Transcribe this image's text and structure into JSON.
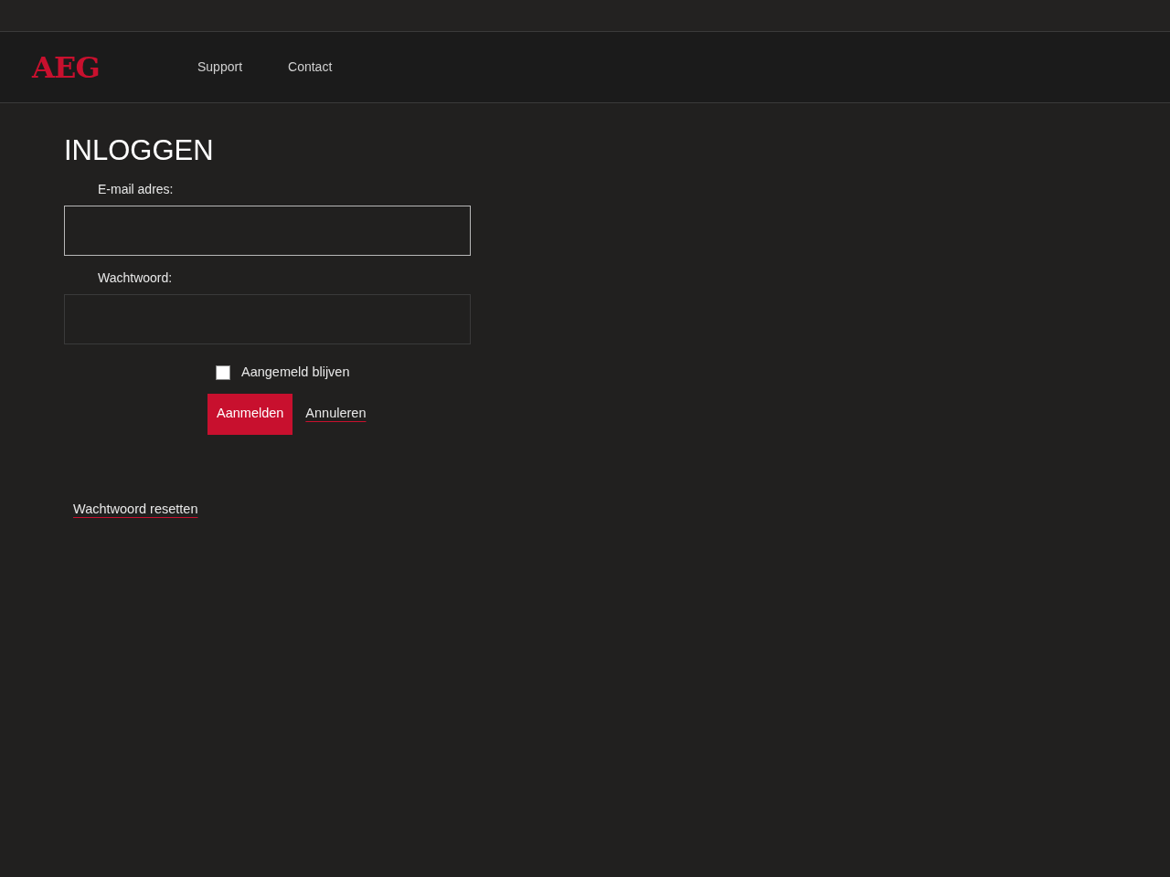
{
  "header": {
    "logo": "AEG",
    "nav": [
      {
        "label": "Support"
      },
      {
        "label": "Contact"
      }
    ]
  },
  "form": {
    "title": "INLOGGEN",
    "fields": [
      {
        "label": "E-mail adres:",
        "focused": true
      },
      {
        "label": "Wachtwoord:",
        "focused": false
      }
    ],
    "remember": {
      "label": "Aangemeld blijven",
      "checked": false
    },
    "submit": "Aanmelden",
    "cancel": "Annuleren"
  },
  "reset_link": "Wachtwoord resetten"
}
